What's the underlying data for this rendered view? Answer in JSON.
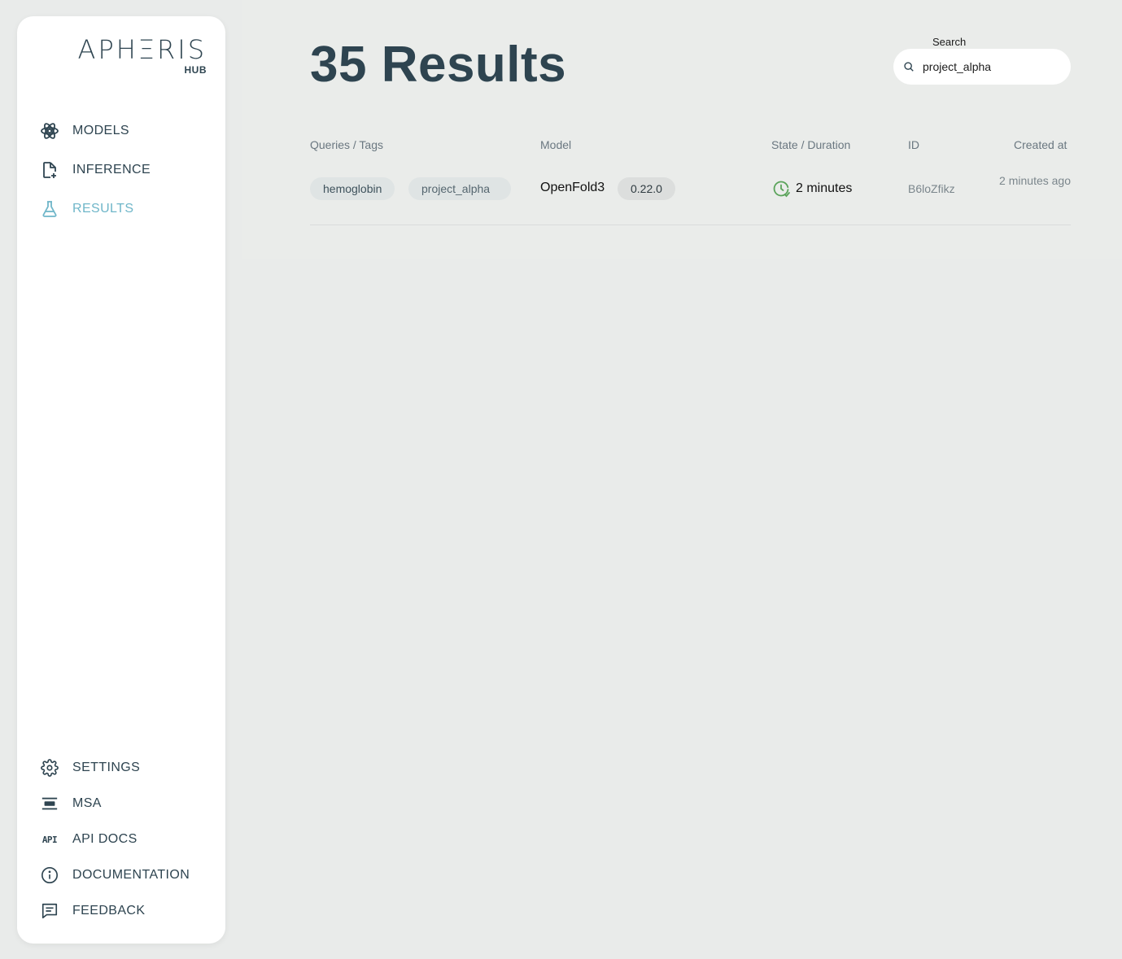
{
  "logo": {
    "name": "APHΞRIS",
    "sub": "HUB"
  },
  "nav": {
    "models": "MODELS",
    "inference": "INFERENCE",
    "results": "RESULTS",
    "settings": "SETTINGS",
    "msa": "MSA",
    "api_docs": "API DOCS",
    "api_glyph": "API",
    "documentation": "DOCUMENTATION",
    "feedback": "FEEDBACK"
  },
  "page": {
    "title": "35 Results"
  },
  "search": {
    "label": "Search",
    "value": "project_alpha"
  },
  "table": {
    "headers": {
      "tags": "Queries / Tags",
      "model": "Model",
      "state": "State / Duration",
      "id": "ID",
      "created": "Created at"
    },
    "rows": [
      {
        "tags": [
          "hemoglobin",
          "project_alpha"
        ],
        "model": "OpenFold3",
        "version": "0.22.0",
        "duration": "2 minutes",
        "id": "B6loZfikz",
        "created": "2 minutes ago"
      }
    ]
  },
  "colors": {
    "accent": "#6fb6c9",
    "success": "#5aa35a",
    "text": "#2e4450"
  }
}
